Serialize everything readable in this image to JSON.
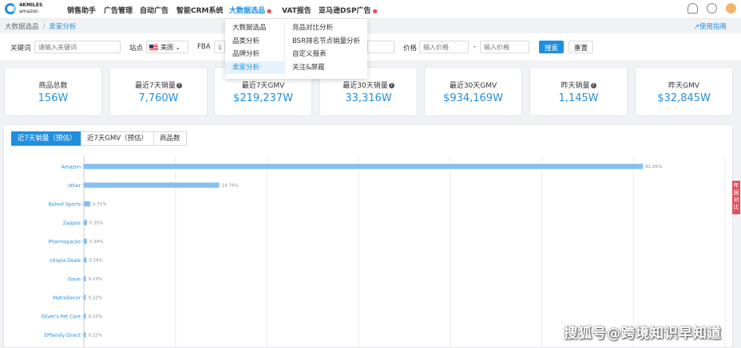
{
  "brand": {
    "line1": "4KMILES",
    "line2": "amazon"
  },
  "nav": {
    "items": [
      {
        "label": "销售助手"
      },
      {
        "label": "广告管理"
      },
      {
        "label": "自动广告"
      },
      {
        "label": "智能CRM系统"
      },
      {
        "label": "大数据选品",
        "active": true,
        "hot": true
      },
      {
        "label": "VAT报告"
      },
      {
        "label": "亚马逊DSP广告",
        "hot": true
      }
    ],
    "hot_icon": "fire-icon"
  },
  "breadcrumb": {
    "root": "大数据选品",
    "separator": "/",
    "current": "卖家分析"
  },
  "help_link": "使用指南",
  "dropdown": {
    "col1": [
      "大数据选品",
      "品类分析",
      "品牌分析",
      "卖家分析"
    ],
    "col2": [
      "竞品对比分析",
      "BSR排名节点销量分析",
      "自定义报表",
      "关注&屏蔽"
    ],
    "selected": "卖家分析"
  },
  "filters": {
    "keyword_label": "关键词",
    "keyword_placeholder": "请输入关键词",
    "site_label": "站点",
    "site_value": "美国",
    "fba_label": "FBA",
    "fba_placeholder": "请",
    "price_label": "价格",
    "price_min_placeholder": "输入价格",
    "price_sep": "-",
    "price_max_placeholder": "输入价格",
    "search_label": "搜索",
    "reset_label": "重置"
  },
  "stats": [
    {
      "label": "商品总数",
      "value": "156W",
      "help": false
    },
    {
      "label": "最近7天销量",
      "value": "7,760W",
      "help": true
    },
    {
      "label": "最近7天GMV",
      "value": "$219,237W",
      "help": false
    },
    {
      "label": "最近30天销量",
      "value": "33,316W",
      "help": true
    },
    {
      "label": "最近30天GMV",
      "value": "$934,169W",
      "help": false
    },
    {
      "label": "昨天销量",
      "value": "1,145W",
      "help": true
    },
    {
      "label": "昨天GMV",
      "value": "$32,845W",
      "help": false
    }
  ],
  "tabs": [
    {
      "label": "近7天销量（预估）",
      "active": true
    },
    {
      "label": "近7天GMV（预估）",
      "active": false
    },
    {
      "label": "商品数",
      "active": false
    }
  ],
  "side_tab": "年 届 对 比",
  "watermark": "搜狐号@跨境知识早知道",
  "colors": {
    "accent": "#1f8fe0",
    "bar": "#85bff0",
    "hot": "#e2515f"
  },
  "chart_data": {
    "type": "bar",
    "orientation": "horizontal",
    "categories": [
      "Amazon",
      "other",
      "Baleaf Sports",
      "Zappos",
      "Pharmapacks",
      "Utopia Deals",
      "iSave",
      "MetroDecor",
      "Oliver's Pet Care",
      "EPfamily Direct"
    ],
    "values": [
      61.05,
      14.79,
      0.71,
      0.35,
      0.34,
      0.29,
      0.23,
      0.22,
      0.22,
      0.22
    ],
    "data_labels": [
      "61.05%",
      "14.79%",
      "0.71%",
      "0.35%",
      "0.34%",
      "0.29%",
      "0.23%",
      "0.22%",
      "0.22%",
      "0.22%"
    ],
    "xlim": [
      0,
      70
    ],
    "grid": true,
    "unit": "%"
  }
}
